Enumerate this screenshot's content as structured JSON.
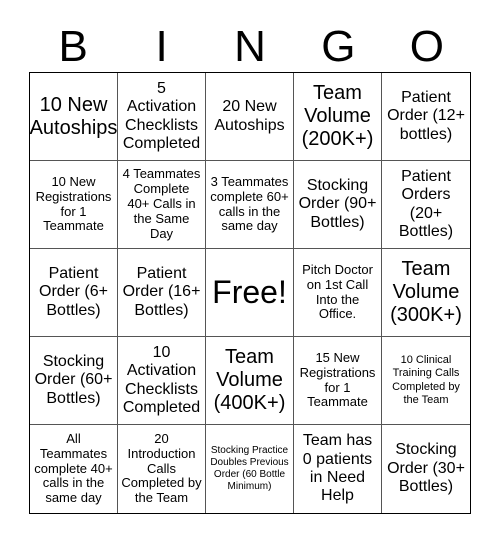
{
  "header": {
    "letters": [
      "B",
      "I",
      "N",
      "G",
      "O"
    ]
  },
  "cells": [
    {
      "text": "10 New Autoships",
      "size": "lg"
    },
    {
      "text": "5 Activation Checklists Completed",
      "size": "md"
    },
    {
      "text": "20 New Autoships",
      "size": "md"
    },
    {
      "text": "Team Volume (200K+)",
      "size": "lg"
    },
    {
      "text": "Patient Order (12+ bottles)",
      "size": "md"
    },
    {
      "text": "10 New Registrations for 1 Teammate",
      "size": "sm"
    },
    {
      "text": "4 Teammates Complete 40+ Calls in the Same Day",
      "size": "sm"
    },
    {
      "text": "3 Teammates complete 60+ calls in the same day",
      "size": "sm"
    },
    {
      "text": "Stocking Order (90+ Bottles)",
      "size": "md"
    },
    {
      "text": "Patient Orders (20+ Bottles)",
      "size": "md"
    },
    {
      "text": "Patient Order (6+ Bottles)",
      "size": "md"
    },
    {
      "text": "Patient Order (16+ Bottles)",
      "size": "md"
    },
    {
      "text": "Free!",
      "size": "xl"
    },
    {
      "text": "Pitch Doctor on 1st Call Into the Office.",
      "size": "sm"
    },
    {
      "text": "Team Volume (300K+)",
      "size": "lg"
    },
    {
      "text": "Stocking Order (60+ Bottles)",
      "size": "md"
    },
    {
      "text": "10 Activation Checklists Completed",
      "size": "md"
    },
    {
      "text": "Team Volume (400K+)",
      "size": "lg"
    },
    {
      "text": "15 New Registrations for 1 Teammate",
      "size": "sm"
    },
    {
      "text": "10 Clinical Training Calls Completed by the Team",
      "size": "xs"
    },
    {
      "text": "All Teammates complete 40+ calls in the same day",
      "size": "sm"
    },
    {
      "text": "20 Introduction Calls Completed by the Team",
      "size": "sm"
    },
    {
      "text": "Stocking Practice Doubles Previous Order (60 Bottle Minimum)",
      "size": "xxs"
    },
    {
      "text": "Team has 0 patients in Need Help",
      "size": "md"
    },
    {
      "text": "Stocking Order (30+ Bottles)",
      "size": "md"
    }
  ]
}
